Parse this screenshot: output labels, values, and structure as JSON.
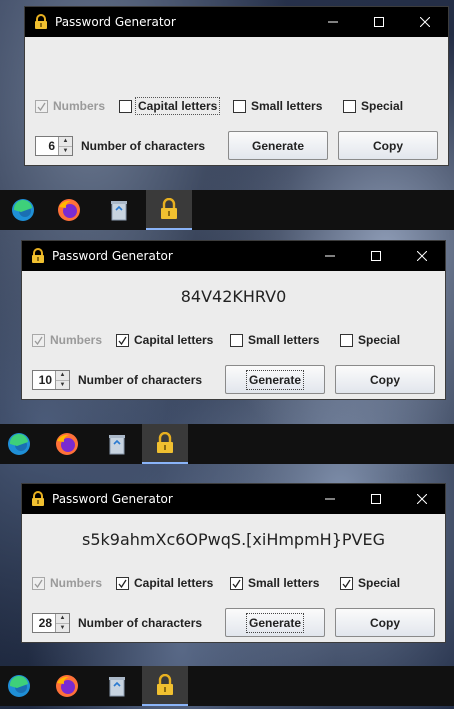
{
  "windows": [
    {
      "title": "Password Generator",
      "password": "",
      "options": {
        "numbers": {
          "label": "Numbers",
          "checked": true,
          "disabled": true
        },
        "capital": {
          "label": "Capital letters",
          "checked": false
        },
        "small": {
          "label": "Small letters",
          "checked": false
        },
        "special": {
          "label": "Special",
          "checked": false
        }
      },
      "length_value": "6",
      "length_label": "Number of characters",
      "generate_label": "Generate",
      "copy_label": "Copy"
    },
    {
      "title": "Password Generator",
      "password": "84V42KHRV0",
      "options": {
        "numbers": {
          "label": "Numbers",
          "checked": true,
          "disabled": true
        },
        "capital": {
          "label": "Capital letters",
          "checked": true
        },
        "small": {
          "label": "Small letters",
          "checked": false
        },
        "special": {
          "label": "Special",
          "checked": false
        }
      },
      "length_value": "10",
      "length_label": "Number of characters",
      "generate_label": "Generate",
      "copy_label": "Copy"
    },
    {
      "title": "Password Generator",
      "password": "s5k9ahmXc6OPwqS.[xiHmpmH}PVEG",
      "options": {
        "numbers": {
          "label": "Numbers",
          "checked": true,
          "disabled": true
        },
        "capital": {
          "label": "Capital letters",
          "checked": true
        },
        "small": {
          "label": "Small letters",
          "checked": true
        },
        "special": {
          "label": "Special",
          "checked": true
        }
      },
      "length_value": "28",
      "length_label": "Number of characters",
      "generate_label": "Generate",
      "copy_label": "Copy"
    }
  ],
  "taskbar": {
    "items": [
      {
        "icon": "edge-icon"
      },
      {
        "icon": "firefox-icon"
      },
      {
        "icon": "recycle-bin-icon"
      },
      {
        "icon": "lock-app-icon",
        "active": true
      }
    ]
  },
  "colors": {
    "titlebar": "#000000",
    "window_bg": "#ececec",
    "taskbar": "#111111",
    "active_task": "#3a3a3a"
  }
}
